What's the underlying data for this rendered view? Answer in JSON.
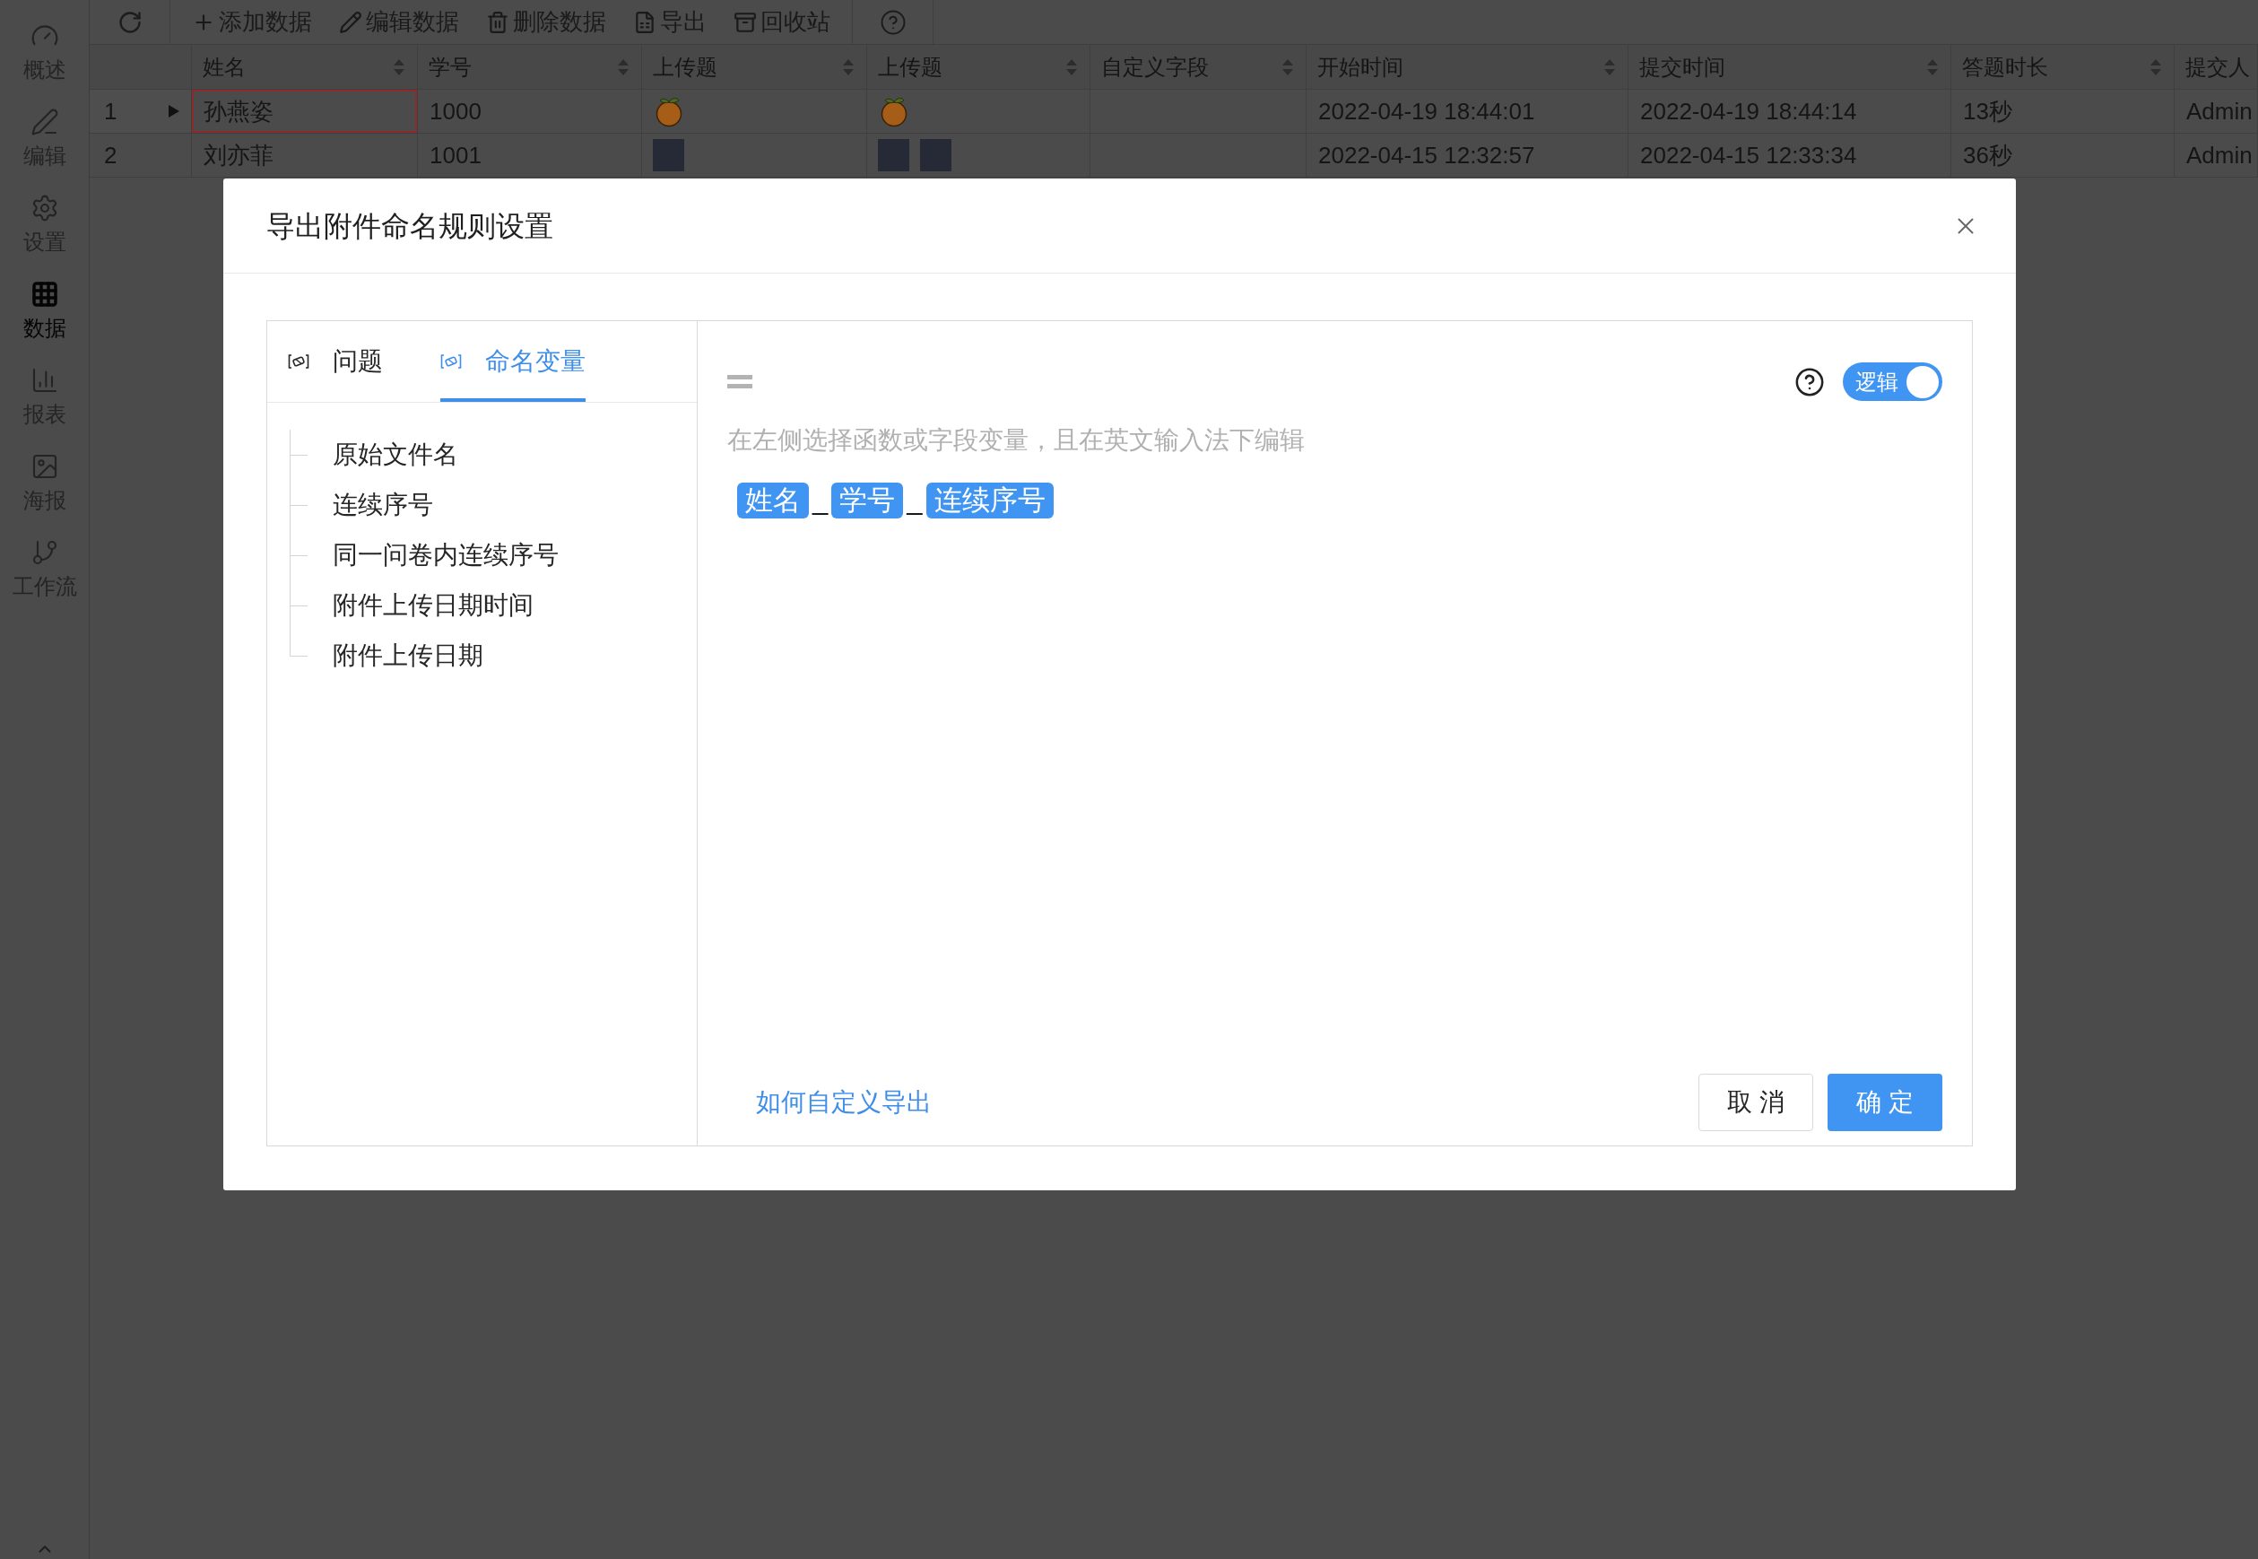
{
  "sidebar": {
    "items": [
      {
        "label": "概述",
        "selected": false
      },
      {
        "label": "编辑",
        "selected": false
      },
      {
        "label": "设置",
        "selected": false
      },
      {
        "label": "数据",
        "selected": true
      },
      {
        "label": "报表",
        "selected": false
      },
      {
        "label": "海报",
        "selected": false
      },
      {
        "label": "工作流",
        "selected": false
      }
    ]
  },
  "toolbar": {
    "buttons": [
      {
        "label": "添加数据"
      },
      {
        "label": "编辑数据"
      },
      {
        "label": "删除数据"
      },
      {
        "label": "导出"
      },
      {
        "label": "回收站"
      }
    ]
  },
  "table": {
    "columns": [
      {
        "label": "姓名",
        "sortable": true
      },
      {
        "label": "学号",
        "sortable": true
      },
      {
        "label": "上传题",
        "sortable": true
      },
      {
        "label": "上传题",
        "sortable": true
      },
      {
        "label": "自定义字段",
        "sortable": true
      },
      {
        "label": "开始时间",
        "sortable": true
      },
      {
        "label": "提交时间",
        "sortable": true
      },
      {
        "label": "答题时长",
        "sortable": true
      },
      {
        "label": "提交人",
        "sortable": false
      }
    ],
    "rows": [
      {
        "number": "1",
        "selected": true,
        "cells": [
          {
            "kind": "text",
            "text": "孙燕姿",
            "selected": true
          },
          {
            "kind": "text",
            "text": "1000",
            "selected": false
          },
          {
            "kind": "images",
            "images": [
              {
                "kind": "fruit"
              }
            ],
            "selected": false
          },
          {
            "kind": "images",
            "images": [
              {
                "kind": "fruit"
              }
            ],
            "selected": false
          },
          {
            "kind": "empty",
            "selected": false
          },
          {
            "kind": "text",
            "text": "2022-04-19 18:44:01",
            "selected": false
          },
          {
            "kind": "text",
            "text": "2022-04-19 18:44:14",
            "selected": false
          },
          {
            "kind": "text",
            "text": "13秒",
            "selected": false
          },
          {
            "kind": "text",
            "text": "Admin",
            "selected": false
          }
        ]
      },
      {
        "number": "2",
        "selected": false,
        "cells": [
          {
            "kind": "text",
            "text": "刘亦菲",
            "selected": false
          },
          {
            "kind": "text",
            "text": "1001",
            "selected": false
          },
          {
            "kind": "images",
            "images": [
              {
                "kind": "photo"
              }
            ],
            "selected": false
          },
          {
            "kind": "images",
            "images": [
              {
                "kind": "photo"
              },
              {
                "kind": "photo"
              }
            ],
            "selected": false
          },
          {
            "kind": "empty",
            "selected": false
          },
          {
            "kind": "text",
            "text": "2022-04-15 12:32:57",
            "selected": false
          },
          {
            "kind": "text",
            "text": "2022-04-15 12:33:34",
            "selected": false
          },
          {
            "kind": "text",
            "text": "36秒",
            "selected": false
          },
          {
            "kind": "text",
            "text": "Admin",
            "selected": false
          }
        ]
      }
    ]
  },
  "dialog": {
    "title": "导出附件命名规则设置",
    "tabs": [
      {
        "label": "问题",
        "selected": false
      },
      {
        "label": "命名变量",
        "selected": true
      }
    ],
    "variables": [
      {
        "label": "原始文件名"
      },
      {
        "label": "连续序号"
      },
      {
        "label": "同一问卷内连续序号"
      },
      {
        "label": "附件上传日期时间"
      },
      {
        "label": "附件上传日期"
      }
    ],
    "editor": {
      "logic_toggle": {
        "label": "逻辑",
        "on": true
      },
      "hint": "在左侧选择函数或字段变量，且在英文输入法下编辑",
      "tokens": [
        {
          "kind": "variable",
          "text": "姓名"
        },
        {
          "kind": "separator",
          "text": "_"
        },
        {
          "kind": "variable",
          "text": "学号"
        },
        {
          "kind": "separator",
          "text": "_"
        },
        {
          "kind": "variable",
          "text": "连续序号"
        }
      ]
    },
    "help_link": "如何自定义导出",
    "buttons": [
      {
        "label": "取 消",
        "kind": "secondary"
      },
      {
        "label": "确 定",
        "kind": "primary"
      }
    ]
  }
}
